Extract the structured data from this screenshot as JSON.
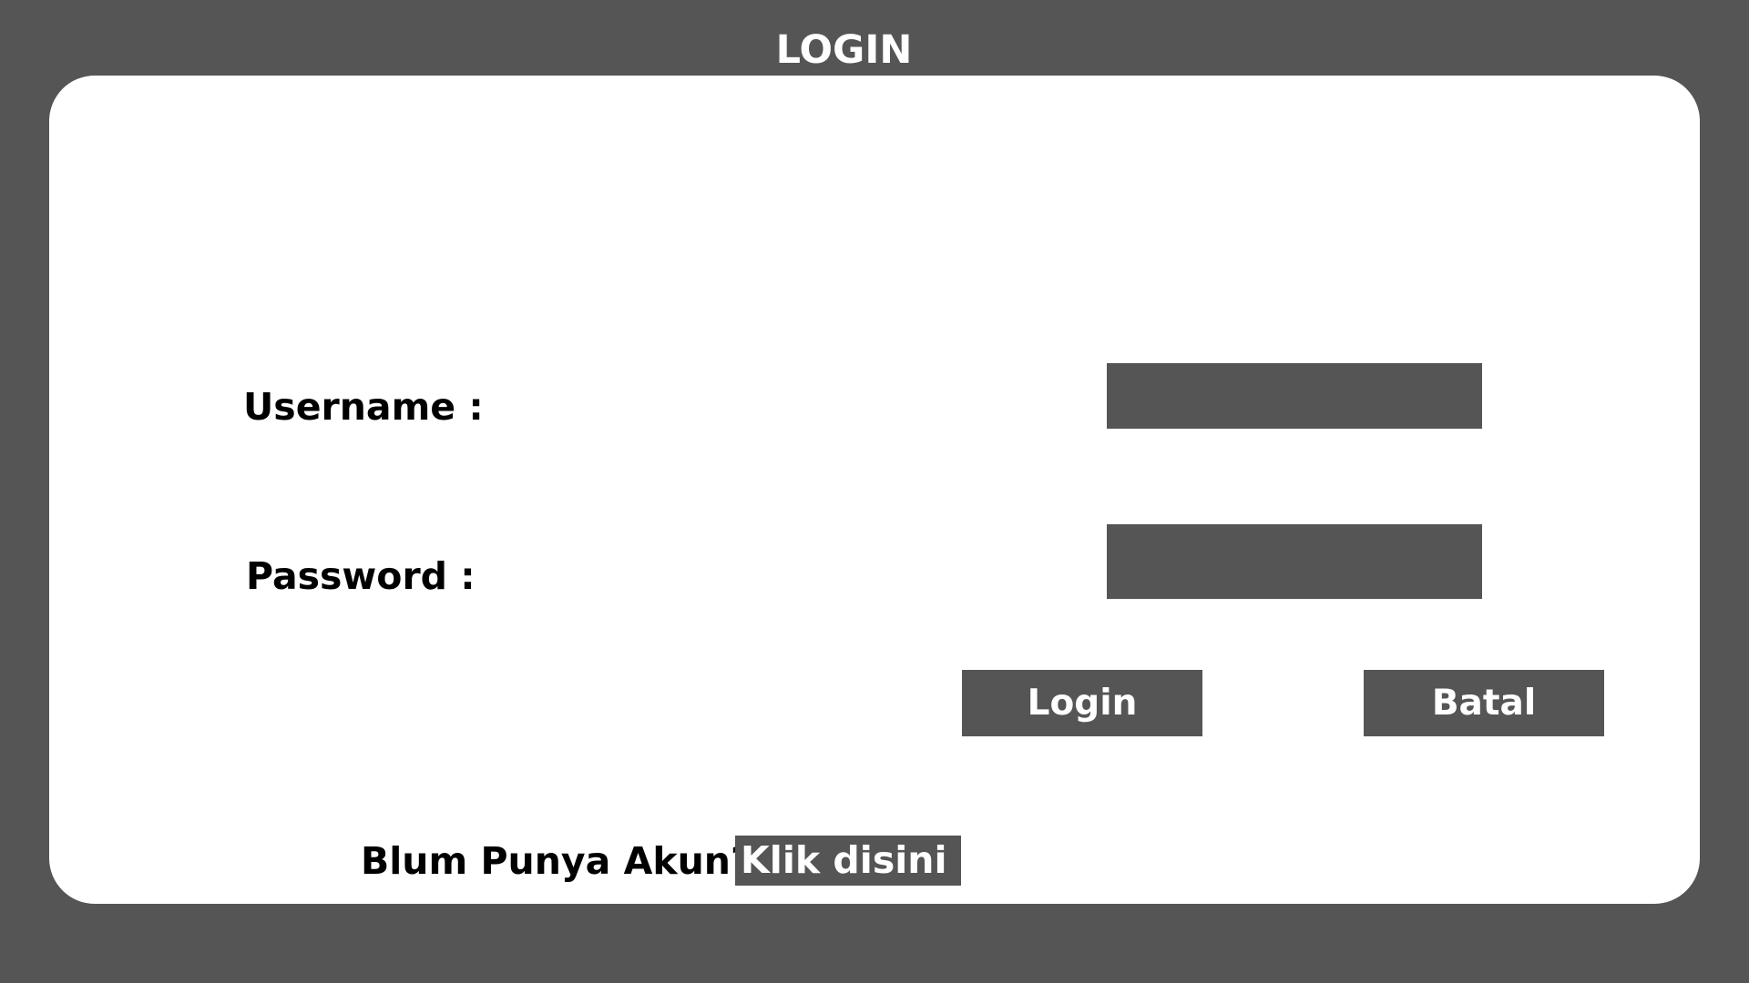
{
  "header": {
    "title": "LOGIN"
  },
  "form": {
    "username_label": "Username :",
    "username_value": "",
    "password_label": "Password :",
    "password_value": "",
    "login_button": "Login",
    "cancel_button": "Batal"
  },
  "register": {
    "prompt": "Blum Punya Akun?",
    "link": "Klik disini"
  },
  "colors": {
    "background": "#555555",
    "card": "#ffffff",
    "control": "#555555",
    "control_text": "#ffffff",
    "label_text": "#000000"
  }
}
